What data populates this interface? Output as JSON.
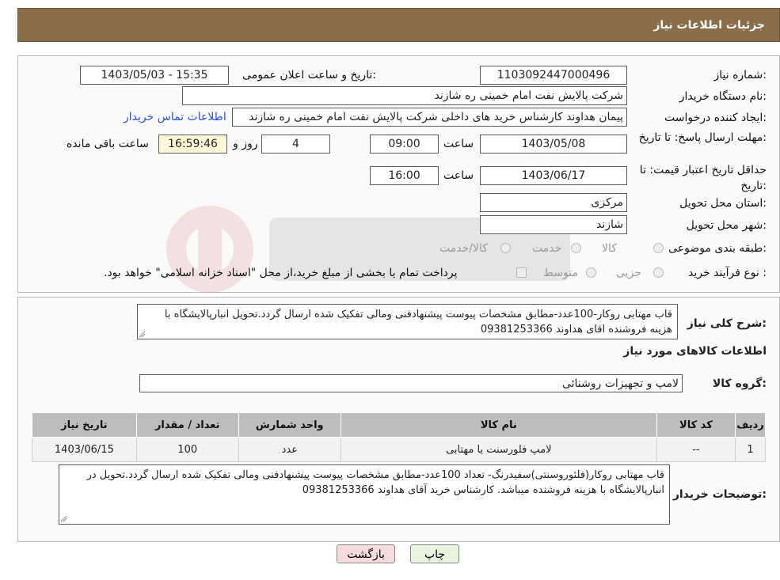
{
  "header": {
    "title": "جزئیات اطلاعات نیاز"
  },
  "form": {
    "need_number_label": "شماره نیاز:",
    "need_number": "1103092447000496",
    "announce_label": "تاریخ و ساعت اعلان عمومی:",
    "announce_value": "1403/05/03 - 15:35",
    "buyer_org_label": "نام دستگاه خریدار:",
    "buyer_org": "شرکت پالایش نفت امام خمینی  ره  شازند",
    "creator_label": "ایجاد کننده درخواست:",
    "creator": "پیمان هداوند کارشناس خرید های داخلی  شرکت پالایش نفت امام خمینی  ره  شازند",
    "contact_link": "اطلاعات تماس خریدار",
    "reply_deadline_label": "مهلت ارسال پاسخ: تا تاریخ:",
    "reply_date": "1403/05/08",
    "time_label": "ساعت",
    "reply_time": "09:00",
    "days_value": "4",
    "days_label": "روز و",
    "remaining_time": "16:59:46",
    "remaining_label": "ساعت باقی مانده",
    "price_validity_label": "حداقل تاریخ اعتبار قیمت: تا تاریخ:",
    "validity_date": "1403/06/17",
    "validity_time": "16:00",
    "province_label": "استان محل تحویل:",
    "province": "مرکزی",
    "city_label": "شهر محل تحویل:",
    "city": "شازند",
    "category_label": "طبقه بندی موضوعی:",
    "category_options": [
      "کالا",
      "خدمت",
      "کالا/خدمت"
    ],
    "purchase_type_label": "نوع فرآیند خرید :",
    "purchase_options": [
      "جزیی",
      "متوسط"
    ],
    "purchase_note": "پرداخت تمام یا بخشی از مبلغ خرید،از محل \"اسناد خزانه اسلامی\" خواهد بود."
  },
  "summary": {
    "title": "شرح کلی نیاز:",
    "text": "قاب مهتابی روکار-100عدد-مطابق مشخصات پیوست پیشنهادفنی ومالی تفکیک شده ارسال گردد.تحویل انبارپالایشگاه با هزینه فروشنده  اقای هداوند 09381253366",
    "goods_info_title": "اطلاعات کالاهای مورد نیاز",
    "goods_group_label": "گروه کالا:",
    "goods_group": "لامپ و تجهیزات روشنائی"
  },
  "table": {
    "headers": [
      "ردیف",
      "کد کالا",
      "نام کالا",
      "واحد شمارش",
      "تعداد / مقدار",
      "تاریخ نیاز"
    ],
    "rows": [
      [
        "1",
        "--",
        "لامپ فلورسنت یا مهتابی",
        "عدد",
        "100",
        "1403/06/15"
      ]
    ]
  },
  "buyer_notes": {
    "label": "توضیحات خریدار:",
    "text": "قاب مهتابی  روکار(فلئوروسنتی)سفیدرنگ- تعداد 100عدد-مطابق مشخصات پیوست پیشنهادفنی ومالی تفکیک شده ارسال گردد.تحویل در انبارپالایشگاه با هزینه فروشنده میباشد. کارشناس خرید آقای هداوند 09381253366"
  },
  "buttons": {
    "print": "چاپ",
    "back": "بازگشت"
  },
  "colors": {
    "header_bg": "#8a6d49",
    "back_button_bg": "#f7dcdc",
    "print_button_bg": "#e7f5e1"
  }
}
